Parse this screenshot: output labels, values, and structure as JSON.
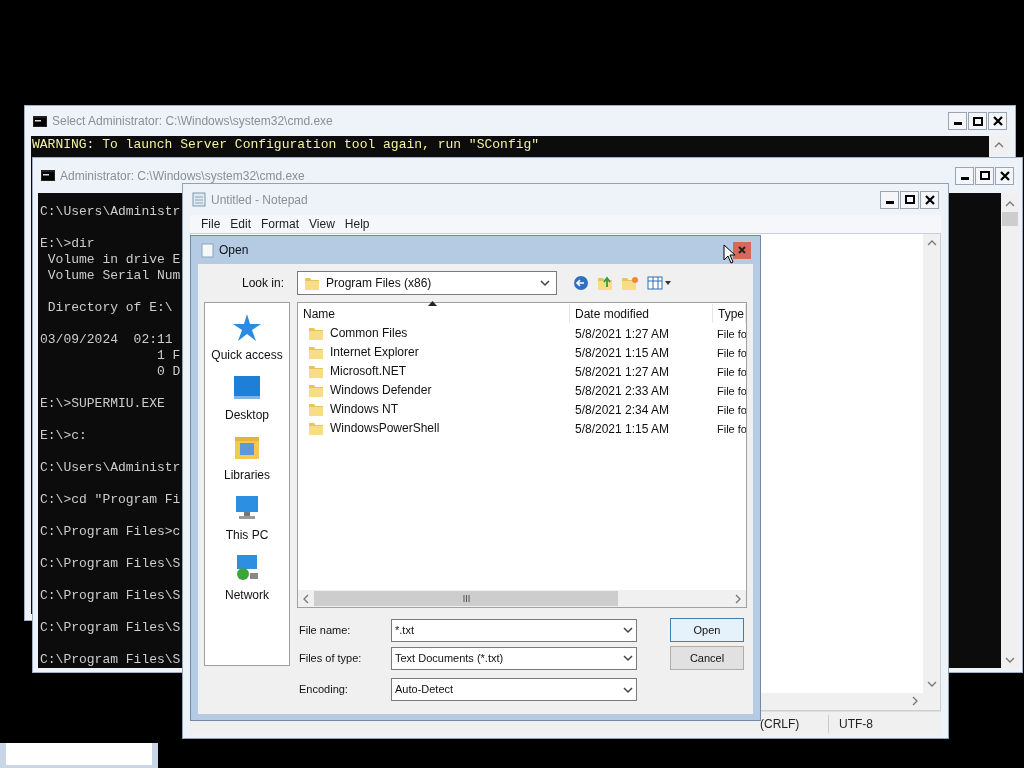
{
  "back_console": {
    "title": "Select Administrator: C:\\Windows\\system32\\cmd.exe",
    "lines": [
      "WARNING: To launch Server Configuration tool again, run \"SConfig\""
    ]
  },
  "front_console": {
    "title": "Administrator: C:\\Windows\\system32\\cmd.exe",
    "blocks": [
      [
        "C:\\Users\\Administr"
      ],
      [
        "E:\\>dir",
        " Volume in drive E",
        " Volume Serial Num"
      ],
      [
        " Directory of E:\\"
      ],
      [
        "03/09/2024  02:11",
        "               1 F",
        "               0 D"
      ],
      [
        "E:\\>SUPERMIU.EXE"
      ],
      [
        "E:\\>c:"
      ],
      [
        "C:\\Users\\Administr"
      ],
      [
        "C:\\>cd \"Program Fi"
      ],
      [
        "C:\\Program Files>c"
      ],
      [
        "C:\\Program Files\\S"
      ],
      [
        "C:\\Program Files\\S"
      ],
      [
        "C:\\Program Files\\S"
      ],
      [
        "C:\\Program Files\\S"
      ]
    ]
  },
  "notepad": {
    "title": "Untitled - Notepad",
    "menu": [
      "File",
      "Edit",
      "Format",
      "View",
      "Help"
    ],
    "status": [
      "(CRLF)",
      "UTF-8"
    ]
  },
  "open_dialog": {
    "title": "Open",
    "look_in_label": "Look in:",
    "look_in": "Program Files (x86)",
    "places": [
      {
        "kind": "star",
        "label": "Quick access"
      },
      {
        "kind": "desktop",
        "label": "Desktop"
      },
      {
        "kind": "libraries",
        "label": "Libraries"
      },
      {
        "kind": "pc",
        "label": "This PC"
      },
      {
        "kind": "network",
        "label": "Network"
      }
    ],
    "columns": [
      "Name",
      "Date modified",
      "Type"
    ],
    "rows": [
      {
        "name": "Common Files",
        "date": "5/8/2021 1:27 AM",
        "type": "File fo"
      },
      {
        "name": "Internet Explorer",
        "date": "5/8/2021 1:15 AM",
        "type": "File fo"
      },
      {
        "name": "Microsoft.NET",
        "date": "5/8/2021 1:27 AM",
        "type": "File fo"
      },
      {
        "name": "Windows Defender",
        "date": "5/8/2021 2:33 AM",
        "type": "File fo"
      },
      {
        "name": "Windows NT",
        "date": "5/8/2021 2:34 AM",
        "type": "File fo"
      },
      {
        "name": "WindowsPowerShell",
        "date": "5/8/2021 1:15 AM",
        "type": "File fo"
      }
    ],
    "file_name_label": "File name:",
    "file_name": "*.txt",
    "file_type_label": "Files of type:",
    "file_type": "Text Documents (*.txt)",
    "encoding_label": "Encoding:",
    "encoding": "Auto-Detect",
    "buttons": [
      "Open",
      "Cancel"
    ]
  }
}
